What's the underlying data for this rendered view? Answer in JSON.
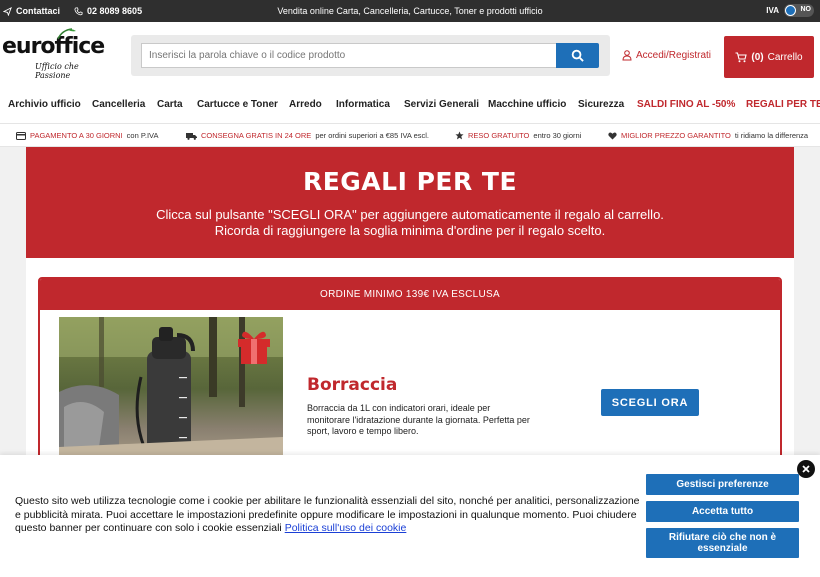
{
  "topbar": {
    "contact_label": "Contattaci",
    "phone": "02 8089 8605",
    "message": "Vendita online Carta, Cancelleria, Cartucce, Toner e prodotti ufficio",
    "iva_label": "IVA",
    "iva_toggle_value": "NO"
  },
  "header": {
    "logo_text": "euroffice",
    "logo_tagline": "Ufficio che Passione",
    "search_placeholder": "Inserisci la parola chiave o il codice prodotto",
    "login_label": "Accedi/Registrati",
    "cart_count": "(0)",
    "cart_label": "Carrello"
  },
  "nav": {
    "items": [
      "Archivio ufficio",
      "Cancelleria",
      "Carta",
      "Cartucce e Toner",
      "Arredo",
      "Informatica",
      "Servizi Generali",
      "Macchine ufficio",
      "Sicurezza",
      "SALDI FINO AL -50%",
      "REGALI PER TE"
    ]
  },
  "benefits": [
    {
      "icon": "card-icon",
      "highlight": "PAGAMENTO A 30 GIORNI",
      "text": "con P.IVA"
    },
    {
      "icon": "truck-icon",
      "highlight": "CONSEGNA GRATIS IN 24 ORE",
      "text": "per ordini superiori a €85 IVA escl."
    },
    {
      "icon": "star-icon",
      "highlight": "RESO GRATUITO",
      "text": "entro 30 giorni"
    },
    {
      "icon": "heart-icon",
      "highlight": "MIGLIOR PREZZO GARANTITO",
      "text": "ti ridiamo la differenza"
    }
  ],
  "hero": {
    "title": "REGALI PER TE",
    "line1": "Clicca sul pulsante \"SCEGLI ORA\" per aggiungere automaticamente il regalo al carrello.",
    "line2": "Ricorda di raggiungere la soglia minima d'ordine per il regalo scelto."
  },
  "gift_card": {
    "header": "ORDINE MINIMO 139€ IVA ESCLUSA",
    "product_name": "Borraccia",
    "product_desc": "Borraccia da 1L con indicatori orari, ideale per monitorare l'idratazione durante la giornata. Perfetta per sport, lavoro e tempo libero.",
    "button": "SCEGLI ORA"
  },
  "cookie": {
    "text": "Questo sito web utilizza tecnologie come i cookie per abilitare le funzionalità essenziali del sito, nonché per analitici, personalizzazione e pubblicità mirata. Puoi accettare le impostazioni predefinite oppure modificare le impostazioni in qualunque momento. Puoi chiudere questo banner per continuare con solo i cookie essenziali",
    "policy_link": "Politica sull'uso dei cookie",
    "manage_button": "Gestisci preferenze",
    "accept_button": "Accetta tutto",
    "reject_button": "Rifiutare ciò che non è essenziale"
  },
  "colors": {
    "brand_red": "#c0282d",
    "brand_blue": "#1e6fb8",
    "topbar": "#2f2f2f"
  }
}
